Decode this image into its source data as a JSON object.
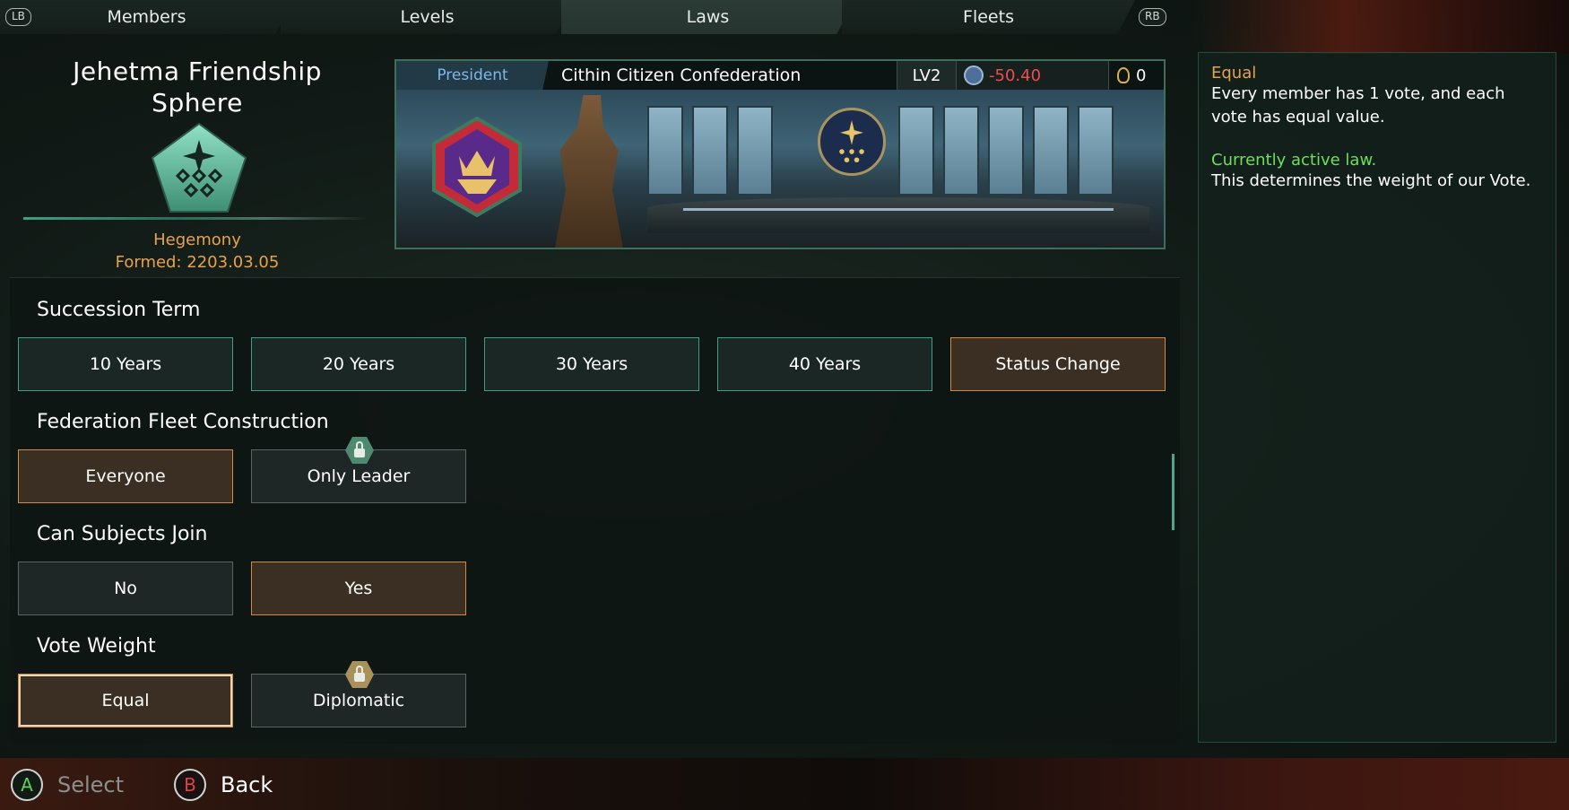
{
  "tabs": {
    "lb": "LB",
    "rb": "RB",
    "items": [
      "Members",
      "Levels",
      "Laws",
      "Fleets"
    ],
    "active": "Laws"
  },
  "federation": {
    "name_line1": "Jehetma Friendship",
    "name_line2": "Sphere",
    "type": "Hegemony",
    "formed": "Formed: 2203.03.05",
    "emblem_icon": "federation-pentagon-icon",
    "emblem_color": "#6fc9a8"
  },
  "president": {
    "label": "President",
    "name": "Cithin Citizen Confederation",
    "level": "LV2",
    "influence": "-50.40",
    "medals": "0",
    "influence_color": "#ef4d4d"
  },
  "description": {
    "title": "Equal",
    "text": "Every member has 1 vote, and each vote has equal value.",
    "active_label": "Currently active law.",
    "explanation": "This determines the weight of our Vote."
  },
  "laws": {
    "succession": {
      "title": "Succession Term",
      "options": [
        "10 Years",
        "20 Years",
        "30 Years",
        "40 Years",
        "Status Change"
      ]
    },
    "fleet": {
      "title": "Federation Fleet Construction",
      "options": [
        "Everyone",
        "Only Leader"
      ]
    },
    "subjects": {
      "title": "Can Subjects Join",
      "options": [
        "No",
        "Yes"
      ]
    },
    "vote": {
      "title": "Vote Weight",
      "options": [
        "Equal",
        "Diplomatic"
      ]
    }
  },
  "footer": {
    "a_glyph": "A",
    "select": "Select",
    "b_glyph": "B",
    "back": "Back"
  },
  "colors": {
    "accent_green": "#3f9f86",
    "accent_orange": "#d28a42",
    "active_law": "#6fdf5a"
  }
}
